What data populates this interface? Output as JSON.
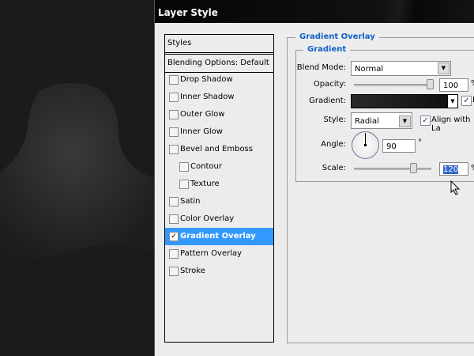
{
  "window": {
    "title": "Layer Style"
  },
  "styles_panel": {
    "header": "Styles",
    "blending": "Blending Options: Default",
    "items": [
      {
        "label": "Drop Shadow",
        "checked": false,
        "indent": false
      },
      {
        "label": "Inner Shadow",
        "checked": false,
        "indent": false
      },
      {
        "label": "Outer Glow",
        "checked": false,
        "indent": false
      },
      {
        "label": "Inner Glow",
        "checked": false,
        "indent": false
      },
      {
        "label": "Bevel and Emboss",
        "checked": false,
        "indent": false
      },
      {
        "label": "Contour",
        "checked": false,
        "indent": true
      },
      {
        "label": "Texture",
        "checked": false,
        "indent": true
      },
      {
        "label": "Satin",
        "checked": false,
        "indent": false
      },
      {
        "label": "Color Overlay",
        "checked": false,
        "indent": false
      },
      {
        "label": "Gradient Overlay",
        "checked": true,
        "indent": false,
        "selected": true
      },
      {
        "label": "Pattern Overlay",
        "checked": false,
        "indent": false
      },
      {
        "label": "Stroke",
        "checked": false,
        "indent": false
      }
    ]
  },
  "gradient_overlay": {
    "section": "Gradient Overlay",
    "group": "Gradient",
    "blend_mode_label": "Blend Mode:",
    "blend_mode": "Normal",
    "opacity_label": "Opacity:",
    "opacity": "100",
    "pct": "%",
    "gradient_label": "Gradient:",
    "reverse_label": "Re",
    "reverse": true,
    "style_label": "Style:",
    "style": "Radial",
    "align_label": "Align with La",
    "align": true,
    "angle_label": "Angle:",
    "angle": "90",
    "deg": "°",
    "scale_label": "Scale:",
    "scale": "120"
  },
  "colors": {
    "selection": "#3399ff",
    "legend": "#1060c8"
  }
}
